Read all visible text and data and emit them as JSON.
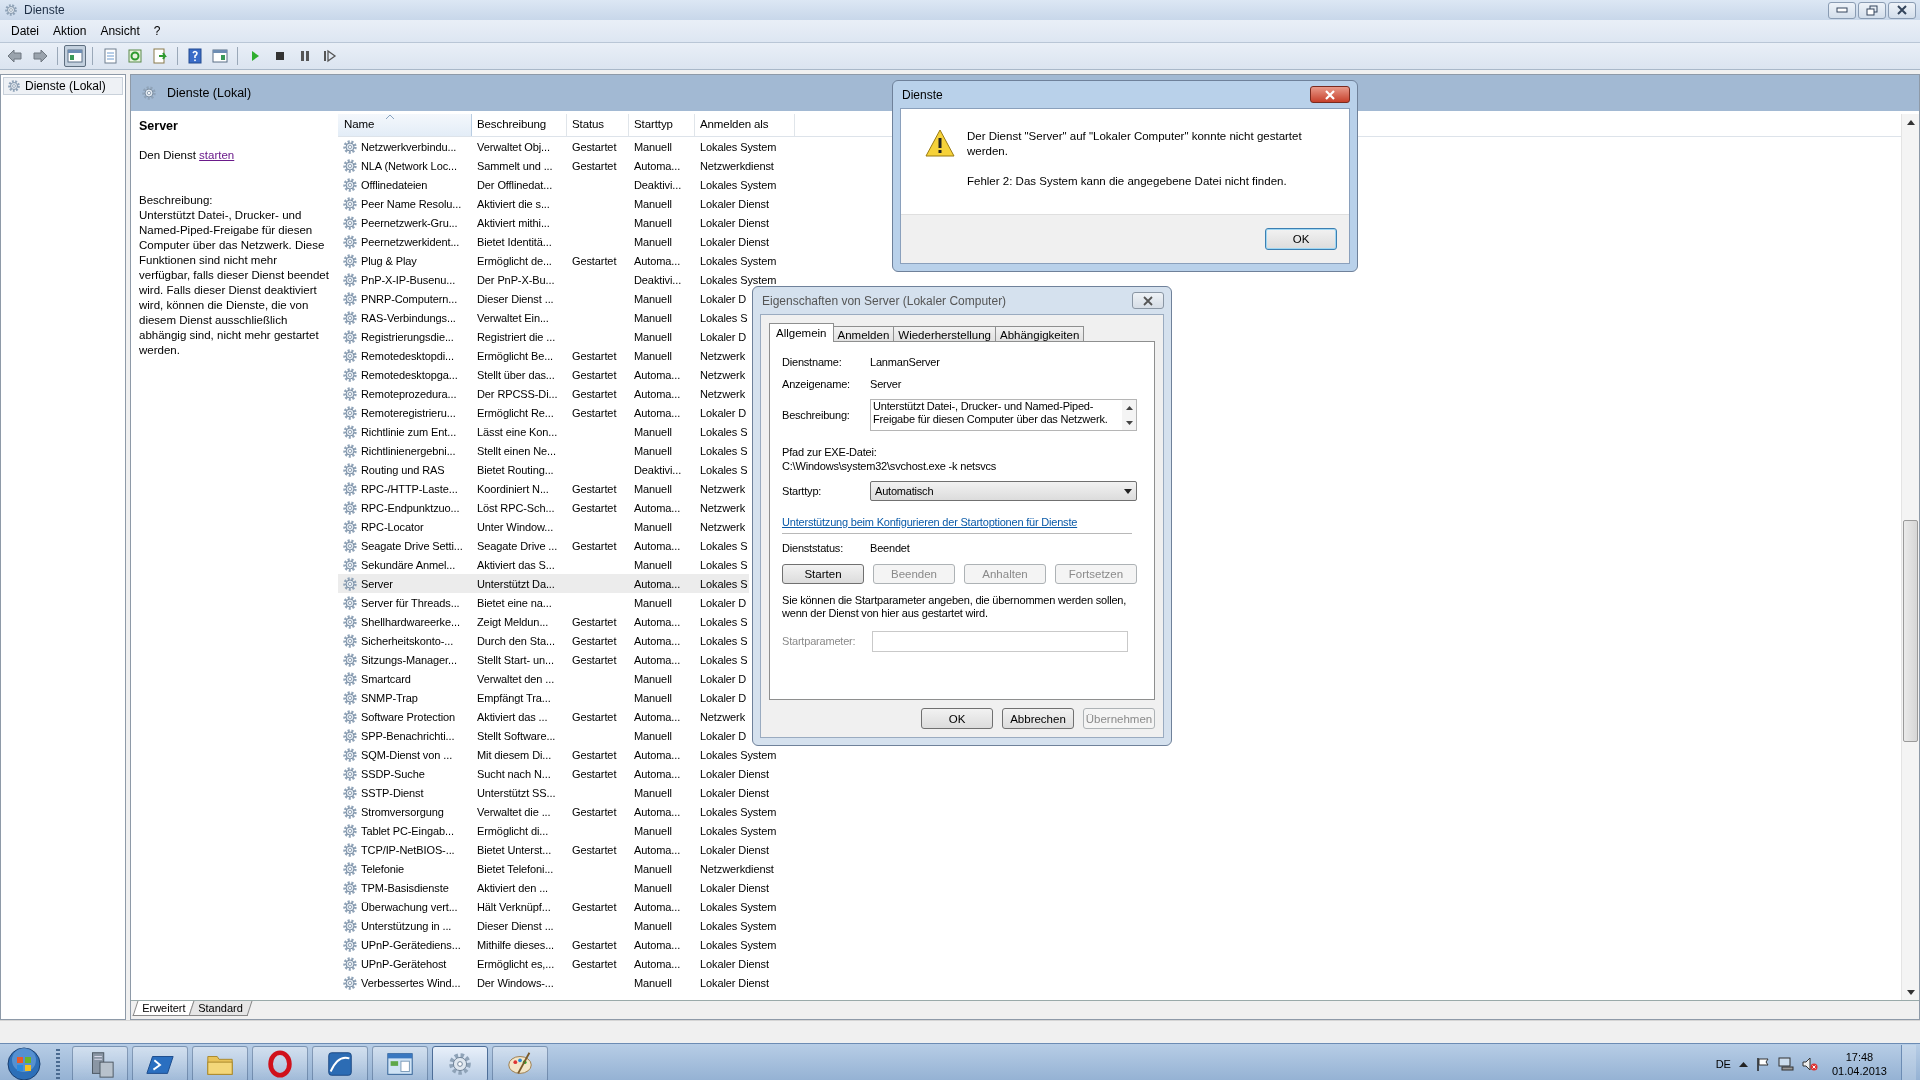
{
  "window": {
    "title": "Dienste"
  },
  "menu": [
    "Datei",
    "Aktion",
    "Ansicht",
    "?"
  ],
  "toolbar": [
    {
      "kind": "back",
      "pressed": false
    },
    {
      "kind": "forward",
      "pressed": false
    },
    {
      "kind": "tree",
      "pressed": true
    },
    {
      "kind": "properties",
      "pressed": false
    },
    {
      "kind": "refresh",
      "pressed": false
    },
    {
      "kind": "export",
      "pressed": false
    },
    {
      "kind": "help",
      "pressed": false
    },
    {
      "kind": "action-pane",
      "pressed": false
    },
    {
      "kind": "play",
      "pressed": false
    },
    {
      "kind": "stop",
      "pressed": false
    },
    {
      "kind": "pause",
      "pressed": false
    },
    {
      "kind": "resume",
      "pressed": false
    }
  ],
  "tree": {
    "items": [
      {
        "label": "Dienste (Lokal)",
        "selected": true
      }
    ]
  },
  "pane_header": {
    "title": "Dienste (Lokal)"
  },
  "details": {
    "title": "Server",
    "action_text": "Den Dienst",
    "action_link": "starten",
    "description_label": "Beschreibung:",
    "description": "Unterstützt Datei-, Drucker- und Named-Piped-Freigabe für diesen Computer über das Netzwerk. Diese Funktionen sind nicht mehr verfügbar, falls dieser Dienst beendet wird. Falls dieser Dienst deaktiviert wird, können die Dienste, die von diesem Dienst ausschließlich abhängig sind, nicht mehr gestartet werden."
  },
  "table": {
    "columns": [
      {
        "label": "Name",
        "sorted": true
      },
      {
        "label": "Beschreibung",
        "sorted": false
      },
      {
        "label": "Status",
        "sorted": false
      },
      {
        "label": "Starttyp",
        "sorted": false
      },
      {
        "label": "Anmelden als",
        "sorted": false
      }
    ],
    "rows": [
      {
        "name": "Netzwerkverbindu...",
        "description": "Verwaltet Obj...",
        "status": "Gestartet",
        "startup": "Manuell",
        "logon": "Lokales System",
        "selected": false
      },
      {
        "name": "NLA (Network Loc...",
        "description": "Sammelt und ...",
        "status": "Gestartet",
        "startup": "Automa...",
        "logon": "Netzwerkdienst",
        "selected": false
      },
      {
        "name": "Offlinedateien",
        "description": "Der Offlinedat...",
        "startup": "Deaktivi...",
        "logon": "Lokales System",
        "selected": false
      },
      {
        "name": "Peer Name Resolu...",
        "description": "Aktiviert die s...",
        "startup": "Manuell",
        "logon": "Lokaler Dienst",
        "selected": false
      },
      {
        "name": "Peernetzwerk-Gru...",
        "description": "Aktiviert mithi...",
        "startup": "Manuell",
        "logon": "Lokaler Dienst",
        "selected": false
      },
      {
        "name": "Peernetzwerkident...",
        "description": "Bietet Identitä...",
        "startup": "Manuell",
        "logon": "Lokaler Dienst",
        "selected": false
      },
      {
        "name": "Plug & Play",
        "description": "Ermöglicht de...",
        "status": "Gestartet",
        "startup": "Automa...",
        "logon": "Lokales System",
        "selected": false
      },
      {
        "name": "PnP-X-IP-Busenu...",
        "description": "Der PnP-X-Bu...",
        "startup": "Deaktivi...",
        "logon": "Lokales System",
        "selected": false
      },
      {
        "name": "PNRP-Computern...",
        "description": "Dieser Dienst ...",
        "startup": "Manuell",
        "logon": "Lokaler D",
        "selected": false
      },
      {
        "name": "RAS-Verbindungs...",
        "description": "Verwaltet Ein...",
        "startup": "Manuell",
        "logon": "Lokales S",
        "selected": false
      },
      {
        "name": "Registrierungsdie...",
        "description": "Registriert die ...",
        "startup": "Manuell",
        "logon": "Lokaler D",
        "selected": false
      },
      {
        "name": "Remotedesktopdi...",
        "description": "Ermöglicht Be...",
        "status": "Gestartet",
        "startup": "Manuell",
        "logon": "Netzwerk",
        "selected": false
      },
      {
        "name": "Remotedesktopga...",
        "description": "Stellt über das...",
        "status": "Gestartet",
        "startup": "Automa...",
        "logon": "Netzwerk",
        "selected": false
      },
      {
        "name": "Remoteprozedura...",
        "description": "Der RPCSS-Di...",
        "status": "Gestartet",
        "startup": "Automa...",
        "logon": "Netzwerk",
        "selected": false
      },
      {
        "name": "Remoteregistrieru...",
        "description": "Ermöglicht Re...",
        "status": "Gestartet",
        "startup": "Automa...",
        "logon": "Lokaler D",
        "selected": false
      },
      {
        "name": "Richtlinie zum Ent...",
        "description": "Lässt eine Kon...",
        "startup": "Manuell",
        "logon": "Lokales S",
        "selected": false
      },
      {
        "name": "Richtlinienergebni...",
        "description": "Stellt einen Ne...",
        "startup": "Manuell",
        "logon": "Lokales S",
        "selected": false
      },
      {
        "name": "Routing und RAS",
        "description": "Bietet Routing...",
        "startup": "Deaktivi...",
        "logon": "Lokales S",
        "selected": false
      },
      {
        "name": "RPC-/HTTP-Laste...",
        "description": "Koordiniert N...",
        "status": "Gestartet",
        "startup": "Manuell",
        "logon": "Netzwerk",
        "selected": false
      },
      {
        "name": "RPC-Endpunktzuo...",
        "description": "Löst RPC-Sch...",
        "status": "Gestartet",
        "startup": "Automa...",
        "logon": "Netzwerk",
        "selected": false
      },
      {
        "name": "RPC-Locator",
        "description": "Unter Window...",
        "startup": "Manuell",
        "logon": "Netzwerk",
        "selected": false
      },
      {
        "name": "Seagate Drive Setti...",
        "description": "Seagate Drive ...",
        "status": "Gestartet",
        "startup": "Automa...",
        "logon": "Lokales S",
        "selected": false
      },
      {
        "name": "Sekundäre Anmel...",
        "description": "Aktiviert das S...",
        "startup": "Manuell",
        "logon": "Lokales S",
        "selected": false
      },
      {
        "name": "Server",
        "description": "Unterstützt Da...",
        "startup": "Automa...",
        "logon": "Lokales S",
        "selected": true
      },
      {
        "name": "Server für Threads...",
        "description": "Bietet eine na...",
        "startup": "Manuell",
        "logon": "Lokaler D",
        "selected": false
      },
      {
        "name": "Shellhardwareerke...",
        "description": "Zeigt Meldun...",
        "status": "Gestartet",
        "startup": "Automa...",
        "logon": "Lokales S",
        "selected": false
      },
      {
        "name": "Sicherheitskonto-...",
        "description": "Durch den Sta...",
        "status": "Gestartet",
        "startup": "Automa...",
        "logon": "Lokales S",
        "selected": false
      },
      {
        "name": "Sitzungs-Manager...",
        "description": "Stellt Start- un...",
        "status": "Gestartet",
        "startup": "Automa...",
        "logon": "Lokales S",
        "selected": false
      },
      {
        "name": "Smartcard",
        "description": "Verwaltet den ...",
        "startup": "Manuell",
        "logon": "Lokaler D",
        "selected": false
      },
      {
        "name": "SNMP-Trap",
        "description": "Empfängt Tra...",
        "startup": "Manuell",
        "logon": "Lokaler D",
        "selected": false
      },
      {
        "name": "Software Protection",
        "description": "Aktiviert das ...",
        "status": "Gestartet",
        "startup": "Automa...",
        "logon": "Netzwerk",
        "selected": false
      },
      {
        "name": "SPP-Benachrichti...",
        "description": "Stellt Software...",
        "startup": "Manuell",
        "logon": "Lokaler D",
        "selected": false
      },
      {
        "name": "SQM-Dienst von ...",
        "description": "Mit diesem Di...",
        "status": "Gestartet",
        "startup": "Automa...",
        "logon": "Lokales System",
        "selected": false
      },
      {
        "name": "SSDP-Suche",
        "description": "Sucht nach N...",
        "status": "Gestartet",
        "startup": "Automa...",
        "logon": "Lokaler Dienst",
        "selected": false
      },
      {
        "name": "SSTP-Dienst",
        "description": "Unterstützt SS...",
        "startup": "Manuell",
        "logon": "Lokaler Dienst",
        "selected": false
      },
      {
        "name": "Stromversorgung",
        "description": "Verwaltet die ...",
        "status": "Gestartet",
        "startup": "Automa...",
        "logon": "Lokales System",
        "selected": false
      },
      {
        "name": "Tablet PC-Eingab...",
        "description": "Ermöglicht di...",
        "startup": "Manuell",
        "logon": "Lokales System",
        "selected": false
      },
      {
        "name": "TCP/IP-NetBIOS-...",
        "description": "Bietet Unterst...",
        "status": "Gestartet",
        "startup": "Automa...",
        "logon": "Lokaler Dienst",
        "selected": false
      },
      {
        "name": "Telefonie",
        "description": "Bietet Telefoni...",
        "startup": "Manuell",
        "logon": "Netzwerkdienst",
        "selected": false
      },
      {
        "name": "TPM-Basisdienste",
        "description": "Aktiviert den ...",
        "startup": "Manuell",
        "logon": "Lokaler Dienst",
        "selected": false
      },
      {
        "name": "Überwachung vert...",
        "description": "Hält Verknüpf...",
        "status": "Gestartet",
        "startup": "Automa...",
        "logon": "Lokales System",
        "selected": false
      },
      {
        "name": "Unterstützung in ...",
        "description": "Dieser Dienst ...",
        "startup": "Manuell",
        "logon": "Lokales System",
        "selected": false
      },
      {
        "name": "UPnP-Gerätediens...",
        "description": "Mithilfe dieses...",
        "status": "Gestartet",
        "startup": "Automa...",
        "logon": "Lokales System",
        "selected": false
      },
      {
        "name": "UPnP-Gerätehost",
        "description": "Ermöglicht es,...",
        "status": "Gestartet",
        "startup": "Automa...",
        "logon": "Lokaler Dienst",
        "selected": false
      },
      {
        "name": "Verbessertes Wind...",
        "description": "Der Windows-...",
        "startup": "Manuell",
        "logon": "Lokaler Dienst",
        "selected": false
      }
    ]
  },
  "view_tabs": [
    {
      "label": "Erweitert",
      "selected": true
    },
    {
      "label": "Standard",
      "selected": false
    }
  ],
  "error_dialog": {
    "title": "Dienste",
    "message": "Der Dienst \"Server\" auf \"Lokaler Computer\" konnte nicht gestartet werden.",
    "error": "Fehler 2: Das System kann die angegebene Datei nicht finden.",
    "button": "OK"
  },
  "properties_dialog": {
    "title": "Eigenschaften von Server (Lokaler Computer)",
    "tabs": [
      {
        "label": "Allgemein",
        "selected": true
      },
      {
        "label": "Anmelden",
        "selected": false
      },
      {
        "label": "Wiederherstellung",
        "selected": false
      },
      {
        "label": "Abhängigkeiten",
        "selected": false
      }
    ],
    "fields": [
      {
        "label": "Dienstname:",
        "value": "LanmanServer"
      },
      {
        "label": "Anzeigename:",
        "value": "Server"
      }
    ],
    "description": {
      "label": "Beschreibung:",
      "value": "Unterstützt Datei-, Drucker- und Named-Piped-Freigabe für diesen Computer über das Netzwerk."
    },
    "path": {
      "label": "Pfad zur EXE-Datei:",
      "value": "C:\\Windows\\system32\\svchost.exe -k netsvcs"
    },
    "startup": {
      "label": "Starttyp:",
      "value": "Automatisch"
    },
    "link": "Unterstützung beim Konfigurieren der Startoptionen für Dienste",
    "status": {
      "label": "Dienststatus:",
      "value": "Beendet"
    },
    "control_buttons": [
      {
        "label": "Starten",
        "disabled": false
      },
      {
        "label": "Beenden",
        "disabled": true
      },
      {
        "label": "Anhalten",
        "disabled": true
      },
      {
        "label": "Fortsetzen",
        "disabled": true
      }
    ],
    "hint": "Sie können die Startparameter angeben, die übernommen werden sollen, wenn der Dienst von hier aus gestartet wird.",
    "start_params": {
      "label": "Startparameter:",
      "disabled": true
    },
    "buttons": [
      {
        "label": "OK",
        "disabled": false
      },
      {
        "label": "Abbrechen",
        "disabled": false
      },
      {
        "label": "Übernehmen",
        "disabled": true
      }
    ]
  },
  "taskbar": {
    "apps": [
      {
        "kind": "server",
        "active": false
      },
      {
        "kind": "terminal",
        "active": false
      },
      {
        "kind": "folder",
        "active": false
      },
      {
        "kind": "ring",
        "active": false
      },
      {
        "kind": "chart",
        "active": false
      },
      {
        "kind": "window",
        "active": false
      },
      {
        "kind": "gear",
        "active": true
      },
      {
        "kind": "palette",
        "active": false
      }
    ],
    "language": "DE",
    "time": "17:48",
    "date": "01.04.2013"
  }
}
